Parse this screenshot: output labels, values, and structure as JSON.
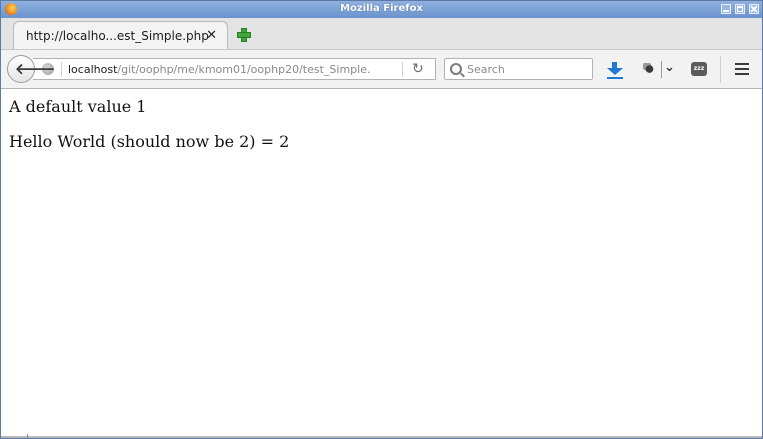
{
  "window": {
    "title": "Mozilla Firefox"
  },
  "tabs": [
    {
      "label": "http://localho...est_Simple.php",
      "close": "✕"
    }
  ],
  "navbar": {
    "url_host": "localhost",
    "url_path": "/git/oophp/me/kmom01/oophp20/test_Simple.",
    "search_placeholder": "Search",
    "pocket_label": "zzz"
  },
  "page": {
    "lines": [
      "A default value 1",
      "Hello World (should now be 2) = 2"
    ]
  },
  "colors": {
    "titlebar": "#7a9fd6",
    "download_accent": "#1e78d6",
    "newtab_accent": "#3ea63a"
  }
}
